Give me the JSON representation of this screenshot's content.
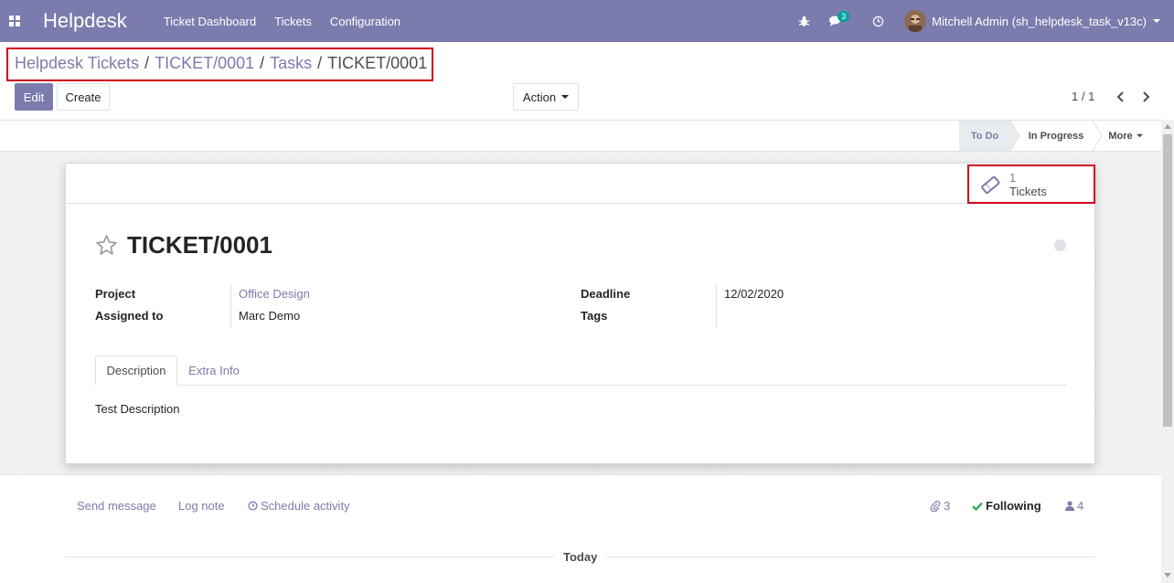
{
  "navbar": {
    "brand": "Helpdesk",
    "menu": [
      "Ticket Dashboard",
      "Tickets",
      "Configuration"
    ],
    "chat_badge": "3",
    "user_name": "Mitchell Admin (sh_helpdesk_task_v13c)"
  },
  "breadcrumb": {
    "items": [
      "Helpdesk Tickets",
      "TICKET/0001",
      "Tasks"
    ],
    "current": "TICKET/0001",
    "separator": "/"
  },
  "toolbar": {
    "edit_label": "Edit",
    "create_label": "Create",
    "action_label": "Action",
    "pager": "1 / 1"
  },
  "statusbar": {
    "stages": [
      "To Do",
      "In Progress"
    ],
    "more_label": "More"
  },
  "smart_button": {
    "count": "1",
    "label": "Tickets"
  },
  "record": {
    "title": "TICKET/0001",
    "fields": {
      "project_label": "Project",
      "project_value": "Office Design",
      "assigned_label": "Assigned to",
      "assigned_value": "Marc Demo",
      "deadline_label": "Deadline",
      "deadline_value": "12/02/2020",
      "tags_label": "Tags"
    },
    "tabs": [
      "Description",
      "Extra Info"
    ],
    "description": "Test Description"
  },
  "chatter": {
    "send_message": "Send message",
    "log_note": "Log note",
    "schedule_activity": "Schedule activity",
    "attachments_count": "3",
    "following_label": "Following",
    "followers_count": "4",
    "today_label": "Today"
  },
  "colors": {
    "brand": "#7c7bad",
    "highlight_border": "#d0021b",
    "success": "#28a745"
  }
}
